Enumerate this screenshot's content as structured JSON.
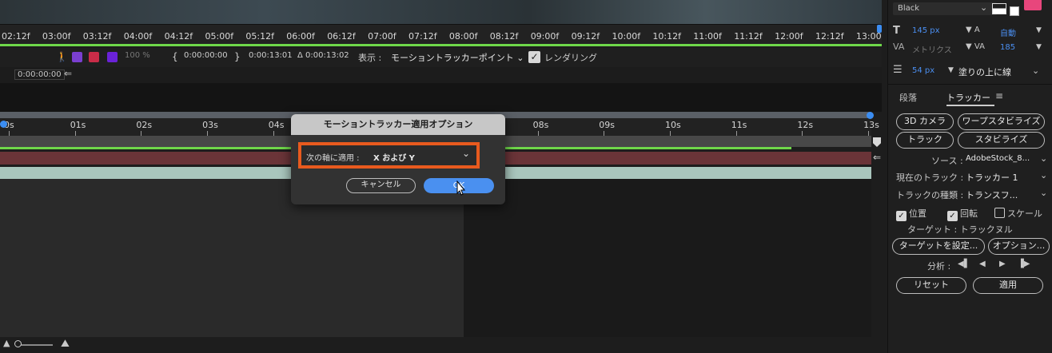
{
  "ruler_top": {
    "ticks": [
      "02:12f",
      "03:00f",
      "03:12f",
      "04:00f",
      "04:12f",
      "05:00f",
      "05:12f",
      "06:00f",
      "06:12f",
      "07:00f",
      "07:12f",
      "08:00f",
      "08:12f",
      "09:00f",
      "09:12f",
      "10:00f",
      "10:12f",
      "11:00f",
      "11:12f",
      "12:00f",
      "12:12f",
      "13:00"
    ]
  },
  "controls": {
    "opacity": "100 %",
    "in_time": "0:00:00:00",
    "out_time": "0:00:13:01",
    "duration": "Δ 0:00:13:02",
    "display_label": "表示 :",
    "display_value": "モーショントラッカーポイント",
    "render_label": "レンダリング",
    "current_time": "0:00:00:00",
    "colors": {
      "purple": "#7a3fd0",
      "red": "#c92c48",
      "violet": "#6a22d8"
    }
  },
  "timeline": {
    "ticks": [
      "0s",
      "01s",
      "02s",
      "03s",
      "04s",
      "05s",
      "06s",
      "07s",
      "08s",
      "09s",
      "10s",
      "11s",
      "12s",
      "13s"
    ]
  },
  "dialog": {
    "title": "モーショントラッカー適用オプション",
    "axis_label": "次の軸に適用 :",
    "axis_value": "X および Y",
    "cancel": "キャンセル",
    "ok": "OK",
    "highlight_color": "#e85a1e"
  },
  "right_panel": {
    "color_mode": "Black",
    "font_size": "145 px",
    "leading": "自動",
    "kerning_label": "メトリクス",
    "tracking": "185",
    "stroke_width": "54 px",
    "stroke_mode": "塗りの上に線",
    "tabs": [
      "段落",
      "トラッカー"
    ],
    "buttons": {
      "camera_3d": "3D カメラ",
      "warp_stabilize": "ワープスタビライズ",
      "track": "トラック",
      "stabilize": "スタビライズ"
    },
    "source_label": "ソース :",
    "source_value": "AdobeStock_8...",
    "current_track_label": "現在のトラック :",
    "current_track_value": "トラッカー 1",
    "track_type_label": "トラックの種類 :",
    "track_type_value": "トランスフ...",
    "checks": {
      "position": "位置",
      "rotation": "回転",
      "scale": "スケール"
    },
    "target_label": "ターゲット : トラックヌル",
    "set_target": "ターゲットを設定...",
    "options": "オプション...",
    "analyze_label": "分析 :",
    "reset": "リセット",
    "apply": "適用"
  }
}
